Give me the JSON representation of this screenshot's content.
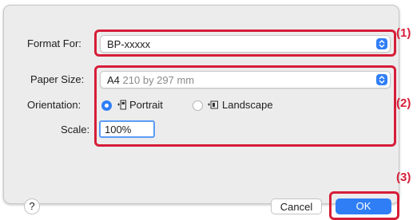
{
  "format_for": {
    "label": "Format For:",
    "value": "BP-xxxxx"
  },
  "paper_size": {
    "label": "Paper Size:",
    "value": "A4",
    "detail": "210 by 297 mm"
  },
  "orientation": {
    "label": "Orientation:",
    "options": [
      {
        "label": "Portrait",
        "selected": true,
        "icon": "portrait-icon"
      },
      {
        "label": "Landscape",
        "selected": false,
        "icon": "landscape-icon"
      }
    ]
  },
  "scale": {
    "label": "Scale:",
    "value": "100%"
  },
  "buttons": {
    "help": "?",
    "cancel": "Cancel",
    "ok": "OK"
  },
  "callouts": {
    "c1": "(1)",
    "c2": "(2)",
    "c3": "(3)"
  },
  "colors": {
    "accent": "#2f7ef6",
    "highlight": "#d61e38",
    "dialog_bg": "#ececec"
  }
}
